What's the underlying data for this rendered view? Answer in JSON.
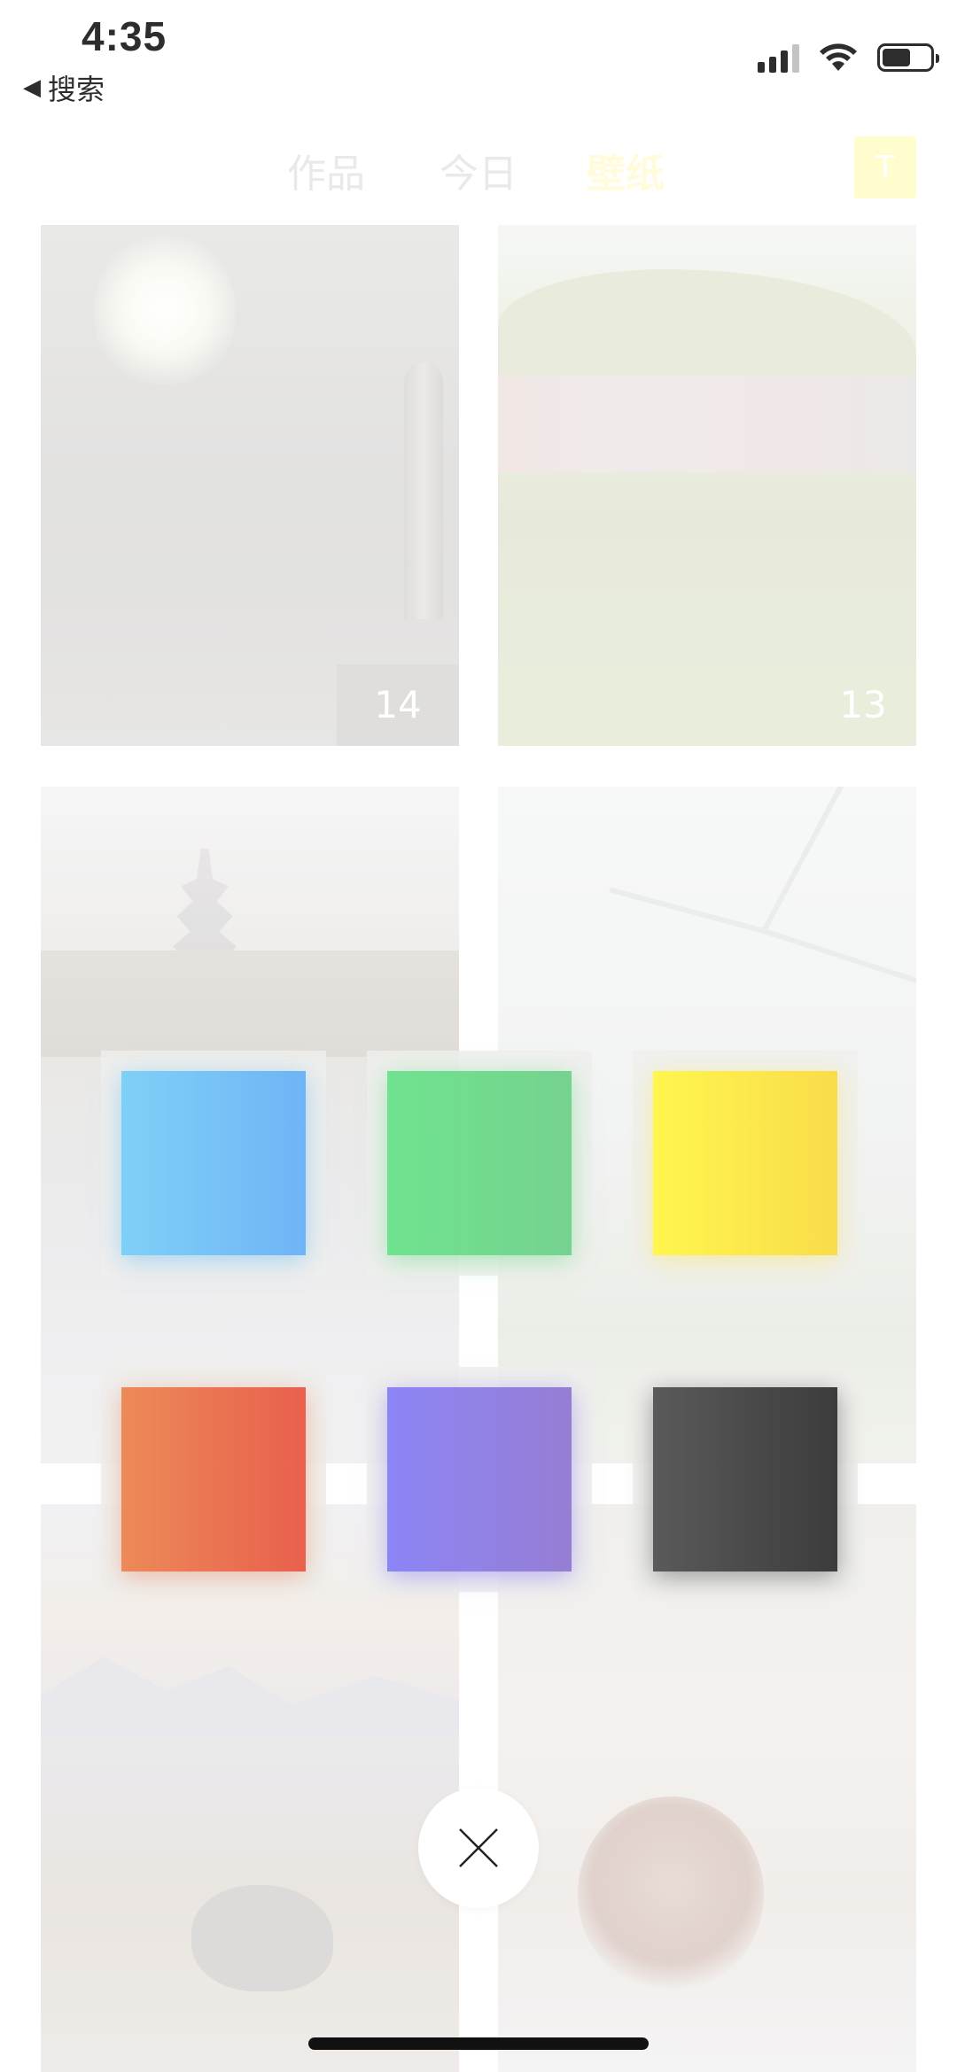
{
  "status_bar": {
    "time": "4:35",
    "back_label": "搜索",
    "back_icon": "back-triangle-icon",
    "icons": [
      "cellular-signal-icon",
      "wifi-icon",
      "battery-icon"
    ]
  },
  "header": {
    "tabs": [
      {
        "label": "作品",
        "active": false
      },
      {
        "label": "今日",
        "active": false
      },
      {
        "label": "壁纸",
        "active": true
      }
    ],
    "avatar_letter": "T"
  },
  "wallpapers": [
    {
      "id": "lamp",
      "count": "14"
    },
    {
      "id": "village",
      "count": "13"
    },
    {
      "id": "pagoda",
      "count": ""
    },
    {
      "id": "windmill",
      "count": ""
    },
    {
      "id": "lake",
      "count": ""
    },
    {
      "id": "red-panda",
      "count": ""
    }
  ],
  "color_picker": {
    "swatches": [
      {
        "name": "blue",
        "colors": [
          "#7fd0f7",
          "#6fb4f6"
        ]
      },
      {
        "name": "green",
        "colors": [
          "#6fe38f",
          "#75d28f"
        ]
      },
      {
        "name": "yellow",
        "colors": [
          "#fff64e",
          "#f9dc4a"
        ]
      },
      {
        "name": "orange",
        "colors": [
          "#ec8a58",
          "#e9604d"
        ]
      },
      {
        "name": "purple",
        "colors": [
          "#8c85f6",
          "#967ed3"
        ]
      },
      {
        "name": "dark-gray",
        "colors": [
          "#5a5a5a",
          "#3c3c3c"
        ]
      }
    ],
    "close_icon": "close-icon"
  }
}
